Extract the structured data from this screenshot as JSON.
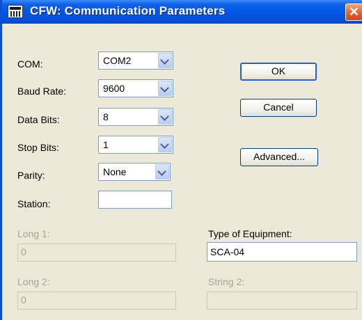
{
  "window": {
    "title": "CFW: Communication Parameters",
    "close_label": "✕"
  },
  "form": {
    "com_label": "COM:",
    "com_value": "COM2",
    "baud_label": "Baud Rate:",
    "baud_value": "9600",
    "databits_label": "Data Bits:",
    "databits_value": "8",
    "stopbits_label": "Stop Bits:",
    "stopbits_value": "1",
    "parity_label": "Parity:",
    "parity_value": "None",
    "station_label": "Station:",
    "station_value": "",
    "long1_label": "Long 1:",
    "long1_value": "0",
    "long2_label": "Long 2:",
    "long2_value": "0",
    "equipment_label": "Type of Equipment:",
    "equipment_value": "SCA-04",
    "string2_label": "String 2:",
    "string2_value": ""
  },
  "buttons": {
    "ok": "OK",
    "cancel": "Cancel",
    "advanced": "Advanced..."
  }
}
